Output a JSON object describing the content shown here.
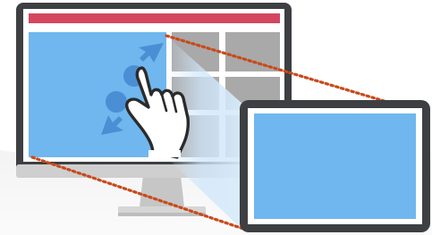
{
  "illustration": {
    "subject": "screen-zoom-to-device",
    "icons": [
      "desktop-monitor-icon",
      "tablet-icon",
      "pinch-hand-icon",
      "zoom-arrow-icon"
    ]
  },
  "colors": {
    "header_bar": "#d4465e",
    "selected_pane": "#6fb7ee",
    "grid_tile": "#a9a9a9",
    "frame": "#3d3f42",
    "bezel": "#ffffff",
    "projection_dots": "#c84a1b",
    "arrow": "#4a8fd4"
  }
}
